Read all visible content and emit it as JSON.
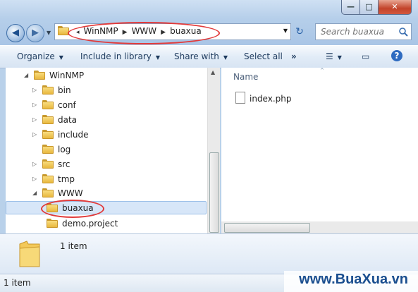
{
  "address": {
    "crumbs": [
      "WinNMP",
      "WWW",
      "buaxua"
    ]
  },
  "search": {
    "placeholder": "Search buaxua"
  },
  "toolbar": {
    "organize": "Organize",
    "include": "Include in library",
    "share": "Share with",
    "selectall": "Select all",
    "more": "»"
  },
  "tree": {
    "root": "WinNMP",
    "children": [
      "bin",
      "conf",
      "data",
      "include",
      "log",
      "src",
      "tmp",
      "WWW"
    ],
    "www_children": [
      "buaxua",
      "demo.project"
    ]
  },
  "content": {
    "column": "Name",
    "files": [
      "index.php"
    ]
  },
  "details": {
    "count": "1 item"
  },
  "status": {
    "count": "1 item"
  },
  "watermark": "www.BuaXua.vn",
  "colors": {
    "highlight": "#e23a3a",
    "selection": "#d7e6f8"
  }
}
